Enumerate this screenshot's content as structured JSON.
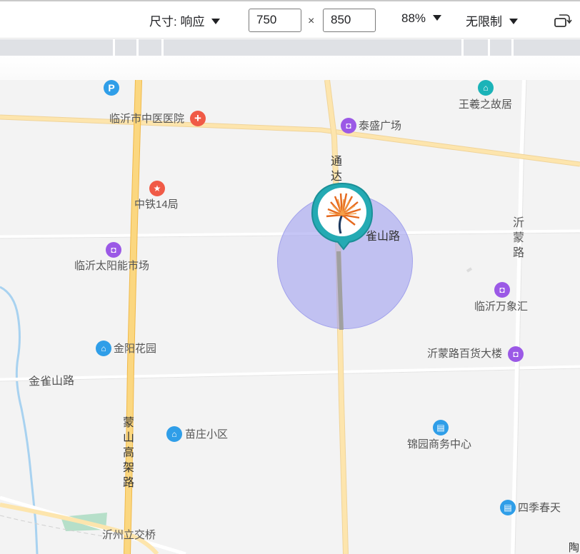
{
  "toolbar": {
    "dimensions_label": "尺寸: 响应",
    "width_value": "750",
    "times_symbol": "×",
    "height_value": "850",
    "zoom_label": "88%",
    "throttle_label": "无限制"
  },
  "map": {
    "pois": {
      "parking": "P",
      "hospital": "临沂市中医医院",
      "wangxi": "王羲之故居",
      "taisheng": "泰盛广场",
      "zhongtie": "中铁14局",
      "solar_market": "临沂太阳能市场",
      "wanxianghui": "临沂万象汇",
      "jinyang": "金阳花园",
      "department_store": "沂蒙路百货大楼",
      "miaozhuang": "苗庄小区",
      "jinyuan": "锦园商务中心",
      "siji": "四季春天",
      "interchange": "沂州立交桥"
    },
    "roads": {
      "tongda": "通达路",
      "jinque_east": "雀山路",
      "yimeng": "沂蒙路",
      "jinque_west": "金雀山路",
      "mengshan": "蒙山高架路",
      "tao_partial": "陶"
    },
    "colors": {
      "background": "#f3f3f3",
      "major_road": "#fbd780",
      "minor_road": "#ffffff",
      "accuracy_circle": "#a0a0f0",
      "marker_ring": "#24aab3",
      "river": "#a8d2f0",
      "green": "#b6dfc9"
    }
  }
}
